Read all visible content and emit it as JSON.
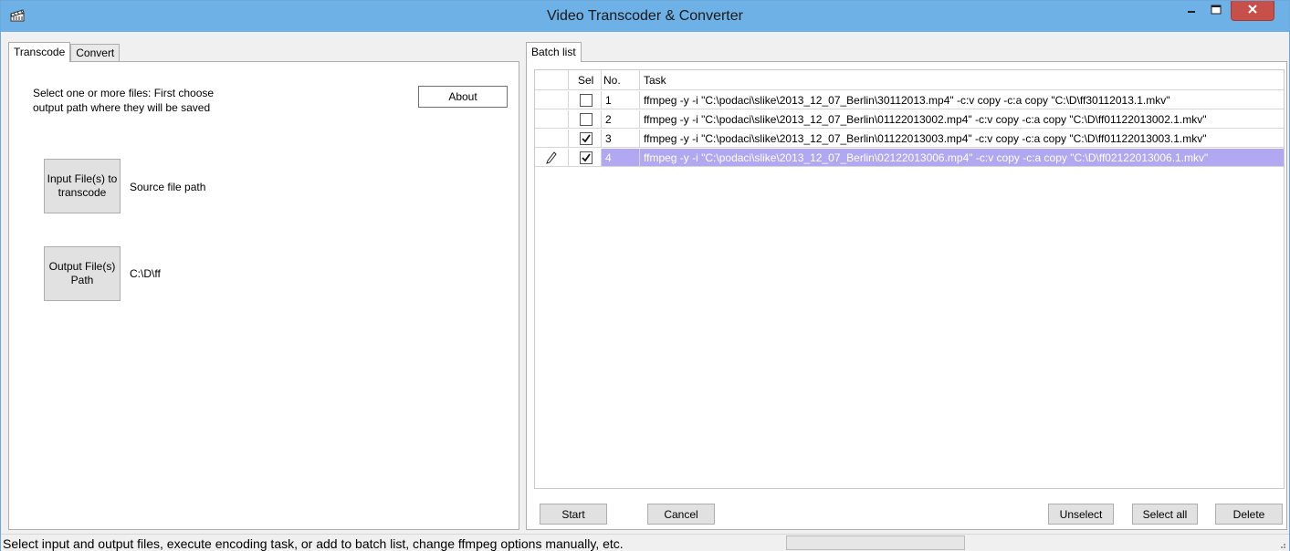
{
  "window": {
    "title": "Video Transcoder & Converter",
    "app_icon": "clapperboard-icon",
    "controls": [
      "minimize-icon",
      "maximize-icon",
      "close-icon"
    ]
  },
  "left_tabs": [
    {
      "label": "Transcode",
      "active": true
    },
    {
      "label": "Convert",
      "active": false
    }
  ],
  "transcode": {
    "instructions": "Select one or more files: First choose output path where they will be saved",
    "about_label": "About",
    "input_button_label": "Input File(s) to transcode",
    "source_path": "Source file path",
    "output_button_label": "Output File(s) Path",
    "output_path": "C:\\D\\ff"
  },
  "right_tabs": [
    {
      "label": "Batch list",
      "active": true
    }
  ],
  "batch": {
    "columns": {
      "sel": "Sel",
      "no": "No.",
      "task": "Task"
    },
    "rows": [
      {
        "no": "1",
        "checked": false,
        "editing": false,
        "task": "ffmpeg -y -i \"C:\\podaci\\slike\\2013_12_07_Berlin\\30112013.mp4\" -c:v copy -c:a copy \"C:\\D\\ff30112013.1.mkv\""
      },
      {
        "no": "2",
        "checked": false,
        "editing": false,
        "task": "ffmpeg -y -i \"C:\\podaci\\slike\\2013_12_07_Berlin\\01122013002.mp4\" -c:v copy -c:a copy \"C:\\D\\ff01122013002.1.mkv\""
      },
      {
        "no": "3",
        "checked": true,
        "editing": false,
        "task": "ffmpeg -y -i \"C:\\podaci\\slike\\2013_12_07_Berlin\\01122013003.mp4\" -c:v copy -c:a copy \"C:\\D\\ff01122013003.1.mkv\""
      },
      {
        "no": "4",
        "checked": true,
        "editing": true,
        "task": "ffmpeg -y -i \"C:\\podaci\\slike\\2013_12_07_Berlin\\02122013006.mp4\" -c:v copy -c:a copy \"C:\\D\\ff02122013006.1.mkv\""
      }
    ],
    "buttons": {
      "start": "Start",
      "cancel": "Cancel",
      "unselect": "Unselect",
      "select_all": "Select all",
      "delete": "Delete"
    }
  },
  "status": {
    "text": "Select input and output files, execute encoding task, or add to batch list, change ffmpeg options manually, etc.",
    "progress": 0
  },
  "colors": {
    "titlebar": "#6db1e6",
    "close_button": "#c7504a",
    "selected_row": "#b0a8f0"
  }
}
